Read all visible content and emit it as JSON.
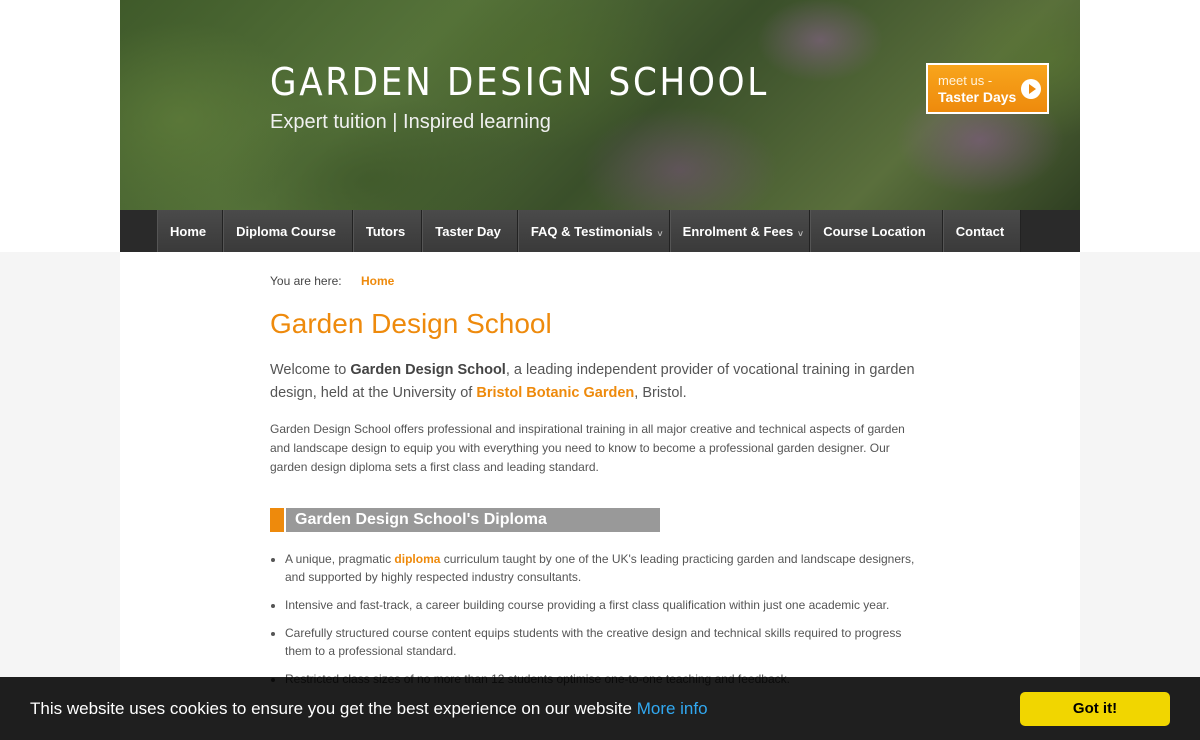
{
  "header": {
    "logo_title": "GARDEN DESIGN SCHOOL",
    "tagline": "Expert tuition  |  Inspired learning",
    "taster_button": {
      "top": "meet us -",
      "bottom": "Taster Days",
      "icon": "play-arrow-icon"
    }
  },
  "nav": {
    "items": [
      {
        "label": "Home",
        "dropdown": false
      },
      {
        "label": "Diploma Course",
        "dropdown": false
      },
      {
        "label": "Tutors",
        "dropdown": false
      },
      {
        "label": "Taster Day",
        "dropdown": false
      },
      {
        "label": "FAQ & Testimonials",
        "dropdown": true
      },
      {
        "label": "Enrolment & Fees",
        "dropdown": true
      },
      {
        "label": "Course Location",
        "dropdown": false
      },
      {
        "label": "Contact",
        "dropdown": false
      }
    ]
  },
  "breadcrumb": {
    "prefix": "You are here:",
    "current": "Home"
  },
  "main": {
    "title": "Garden Design School",
    "intro": {
      "p1": "Welcome to ",
      "bold": "Garden Design School",
      "p2": ", a leading independent provider of vocational training in garden design, held at the University of ",
      "link": "Bristol Botanic Garden",
      "p3": ", Bristol."
    },
    "paragraph": "Garden Design School offers professional and inspirational training in all major creative and technical aspects of garden and landscape design to equip you with everything you need to know to become a professional garden designer.  Our garden design diploma sets a first class and leading standard.",
    "section_title": "Garden Design School's Diploma",
    "bullets": [
      {
        "pre": "A unique, pragmatic ",
        "link": "diploma",
        "post": " curriculum taught by one of the UK's leading practicing garden and landscape designers, and supported by highly respected industry consultants."
      },
      {
        "pre": "Intensive and fast-track, a career building course providing a first class qualification within just one academic year.",
        "link": "",
        "post": ""
      },
      {
        "pre": "Carefully structured course content equips students with the creative design and technical skills required to progress them to a professional standard.",
        "link": "",
        "post": ""
      },
      {
        "pre": "Restricted class sizes of no more than 12 students optimise one-to-one teaching and feedback.",
        "link": "",
        "post": ""
      }
    ]
  },
  "cookie": {
    "text": "This website uses cookies to ensure you get the best experience on our website",
    "more": "More info",
    "button": "Got it!"
  },
  "colors": {
    "accent": "#ee8a0c",
    "cookie_button": "#f1d600",
    "link_blue": "#31a8f0"
  }
}
